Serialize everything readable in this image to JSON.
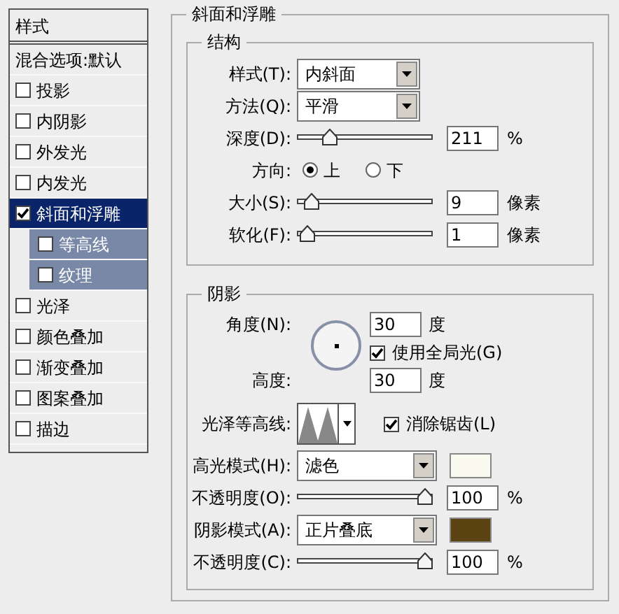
{
  "sidebar": {
    "title": "样式",
    "items": [
      {
        "kind": "header",
        "label": "混合选项:默认",
        "selected": false
      },
      {
        "kind": "check",
        "label": "投影",
        "checked": false,
        "selected": false
      },
      {
        "kind": "check",
        "label": "内阴影",
        "checked": false,
        "selected": false
      },
      {
        "kind": "check",
        "label": "外发光",
        "checked": false,
        "selected": false
      },
      {
        "kind": "check",
        "label": "内发光",
        "checked": false,
        "selected": false
      },
      {
        "kind": "check",
        "label": "斜面和浮雕",
        "checked": true,
        "selected": true,
        "children": [
          {
            "kind": "check",
            "label": "等高线",
            "checked": false,
            "selected": false
          },
          {
            "kind": "check",
            "label": "纹理",
            "checked": false,
            "selected": false
          }
        ]
      },
      {
        "kind": "check",
        "label": "光泽",
        "checked": false,
        "selected": false
      },
      {
        "kind": "check",
        "label": "颜色叠加",
        "checked": false,
        "selected": false
      },
      {
        "kind": "check",
        "label": "渐变叠加",
        "checked": false,
        "selected": false
      },
      {
        "kind": "check",
        "label": "图案叠加",
        "checked": false,
        "selected": false
      },
      {
        "kind": "check",
        "label": "描边",
        "checked": false,
        "selected": false
      }
    ]
  },
  "panel": {
    "title": "斜面和浮雕",
    "structure": {
      "title": "结构",
      "rows": [
        {
          "kind": "select",
          "label": "样式(T):",
          "value": "内斜面"
        },
        {
          "kind": "select",
          "label": "方法(Q):",
          "value": "平滑"
        },
        {
          "kind": "slider",
          "label": "深度(D):",
          "level": 0.21,
          "value": "211",
          "unit": "%"
        },
        {
          "kind": "radio",
          "label": "方向:",
          "options": [
            {
              "label": "上",
              "selected": true
            },
            {
              "label": "下",
              "selected": false
            }
          ]
        },
        {
          "kind": "slider",
          "label": "大小(S):",
          "level": 0.06,
          "value": "9",
          "unit": "像素"
        },
        {
          "kind": "slider",
          "label": "软化(F):",
          "level": 0.02,
          "value": "1",
          "unit": "像素"
        }
      ]
    },
    "shading": {
      "title": "阴影",
      "angle": {
        "label": "角度(N):",
        "value": "30",
        "unit": "度"
      },
      "global_light": {
        "label": "使用全局光(G)",
        "checked": true
      },
      "altitude": {
        "label": "高度:",
        "value": "30",
        "unit": "度"
      },
      "gloss_contour": {
        "label": "光泽等高线:"
      },
      "anti_alias": {
        "label": "消除锯齿(L)",
        "checked": true
      },
      "rows": [
        {
          "kind": "select",
          "label": "高光模式(H):",
          "value": "滤色",
          "color": "#fafaf0"
        },
        {
          "kind": "slider",
          "label": "不透明度(O):",
          "level": 1,
          "value": "100",
          "unit": "%"
        },
        {
          "kind": "select",
          "label": "阴影模式(A):",
          "value": "正片叠底",
          "color": "#5a4310"
        },
        {
          "kind": "slider",
          "label": "不透明度(C):",
          "level": 1,
          "value": "100",
          "unit": "%"
        }
      ]
    }
  }
}
